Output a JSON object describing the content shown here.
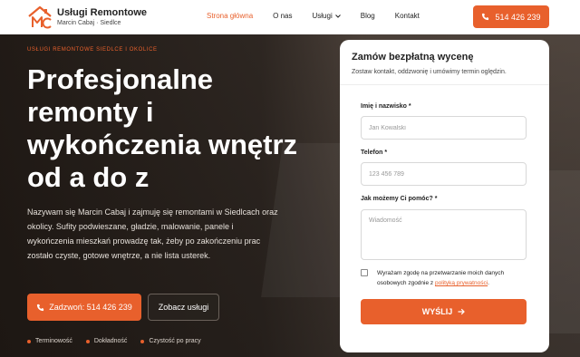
{
  "brand": {
    "title": "Usługi Remontowe",
    "subtitle": "Marcin Cabaj · Siedlce"
  },
  "nav": {
    "items": [
      "Strona główna",
      "O nas",
      "Usługi",
      "Blog",
      "Kontakt"
    ]
  },
  "header_phone": "514 426 239",
  "hero": {
    "eyebrow": "USŁUGI REMONTOWE SIEDLCE I OKOLICE",
    "headline": "Profesjonalne remonty i wykończenia wnętrz od a do z",
    "description": "Nazywam się Marcin Cabaj i zajmuję się remontami w Siedlcach oraz okolicy. Sufity podwieszane, gładzie, malowanie, panele i wykończenia mieszkań prowadzę tak, żeby po zakończeniu prac zostało czyste, gotowe wnętrze, a nie lista usterek.",
    "cta_call": "Zadzwoń: 514 426 239",
    "cta_services": "Zobacz usługi",
    "features": [
      "Terminowość",
      "Dokładność",
      "Czystość po pracy"
    ]
  },
  "form": {
    "title": "Zamów bezpłatną wycenę",
    "subtitle": "Zostaw kontakt, oddzwonię i umówimy termin oględzin.",
    "name_label": "Imię i nazwisko *",
    "name_placeholder": "Jan Kowalski",
    "phone_label": "Telefon *",
    "phone_placeholder": "123 456 789",
    "message_label": "Jak możemy Ci pomóc? *",
    "message_placeholder": "Wiadomość",
    "consent_text": "Wyrażam zgodę na przetwarzanie moich danych osobowych zgodnie z ",
    "consent_link": "polityką prywatności",
    "consent_end": ".",
    "submit": "WYŚLIJ"
  },
  "colors": {
    "accent": "#e8602c",
    "dark": "#2a2420"
  }
}
